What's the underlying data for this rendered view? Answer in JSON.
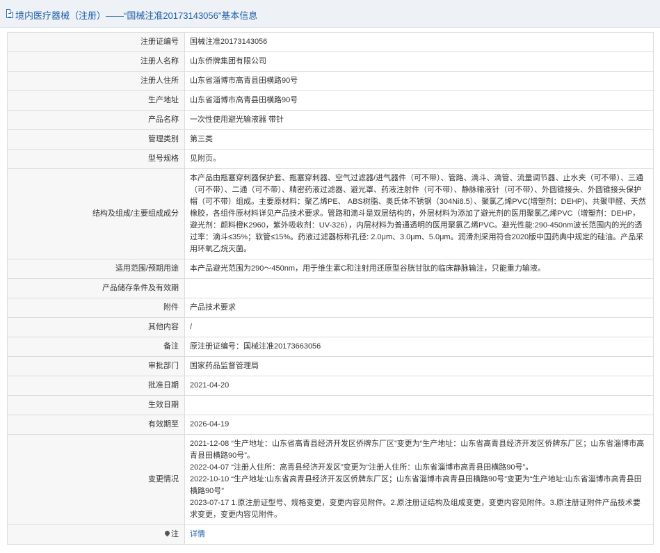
{
  "header": {
    "title": "境内医疗器械（注册）——“国械注准20173143056”基本信息"
  },
  "rows": {
    "reg_no": {
      "label": "注册证编号",
      "value": "国械注准20173143056"
    },
    "registrant_name": {
      "label": "注册人名称",
      "value": "山东侨牌集团有限公司"
    },
    "registrant_address": {
      "label": "注册人住所",
      "value": "山东省淄博市高青县田横路90号"
    },
    "production_address": {
      "label": "生产地址",
      "value": "山东省淄博市高青县田横路90号"
    },
    "product_name": {
      "label": "产品名称",
      "value": "一次性使用避光输液器 带针"
    },
    "category": {
      "label": "管理类别",
      "value": "第三类"
    },
    "model_spec": {
      "label": "型号规格",
      "value": "见附页。"
    },
    "composition": {
      "label": "结构及组成/主要组成成分",
      "value": "本产品由瓶塞穿刺器保护套、瓶塞穿刺器、空气过滤器/进气器件（可不带）、管路、滴斗、滴管、流量调节器、止水夹（可不带）、三通（可不带）、二通（可不带）、精密药液过滤器、避光罩、药液注射件（可不带）、静脉输液针（可不带）、外圆锥接头、外圆锥接头保护帽（可不带）组成。主要原材料：聚乙烯PE、 ABS树脂、奥氏体不锈钢（304Ni8.5）、聚氯乙烯PVC(增塑剂：DEHP)、共聚甲醛、天然橡胶，各组件原材料详见产品技术要求。管路和滴斗是双层结构的，外层材料为添加了避光剂的医用聚氯乙烯PVC（增塑剂：DEHP，避光剂：颜料橙K2960，紫外吸收剂：UV-326），内层材料为普通透明的医用聚氯乙烯PVC。避光性能:290-450nm波长范围内的光的透过率：滴斗≤35%；软管≤15%。药液过滤器标称孔径: 2.0μm、3.0μm、5.0μm。润滑剂采用符合2020版中国药典中规定的硅油。产品采用环氧乙烷灭菌。"
    },
    "scope": {
      "label": "适用范围/预期用途",
      "value": "本产品避光范围为290～450nm，用于维生素C和注射用还原型谷胱甘肽的临床静脉输注，只能重力输液。"
    },
    "storage": {
      "label": "产品储存条件及有效期",
      "value": ""
    },
    "attachment": {
      "label": "附件",
      "value": "产品技术要求"
    },
    "other": {
      "label": "其他内容",
      "value": "/"
    },
    "remark": {
      "label": "备注",
      "value": "原注册证编号：国械注准20173663056"
    },
    "approval_dept": {
      "label": "审批部门",
      "value": "国家药品监督管理局"
    },
    "approval_date": {
      "label": "批准日期",
      "value": "2021-04-20"
    },
    "effective_date": {
      "label": "生效日期",
      "value": ""
    },
    "expiry_date": {
      "label": "有效期至",
      "value": "2026-04-19"
    },
    "changes": {
      "label": "变更情况",
      "entries": [
        "2021-12-08 “生产地址：山东省高青县经济开发区侨牌东厂区”变更为“生产地址：山东省高青县经济开发区侨牌东厂区；山东省淄博市高青县田横路90号”。",
        "2022-04-07 “注册人住所：高青县经济开发区”变更为“注册人住所：山东省淄博市高青县田横路90号”。",
        "2022-10-10 “生产地址:山东省高青县经济开发区侨牌东厂区；山东省淄博市高青县田横路90号”变更为“生产地址:山东省淄博市高青县田横路90号”",
        "2023-07-17 1.原注册证型号、规格变更，变更内容见附件。2.原注册证结构及组成变更，变更内容见附件。3.原注册证附件产品技术要求变更，变更内容见附件。"
      ]
    },
    "note": {
      "label": "注",
      "link_text": "详情"
    }
  }
}
